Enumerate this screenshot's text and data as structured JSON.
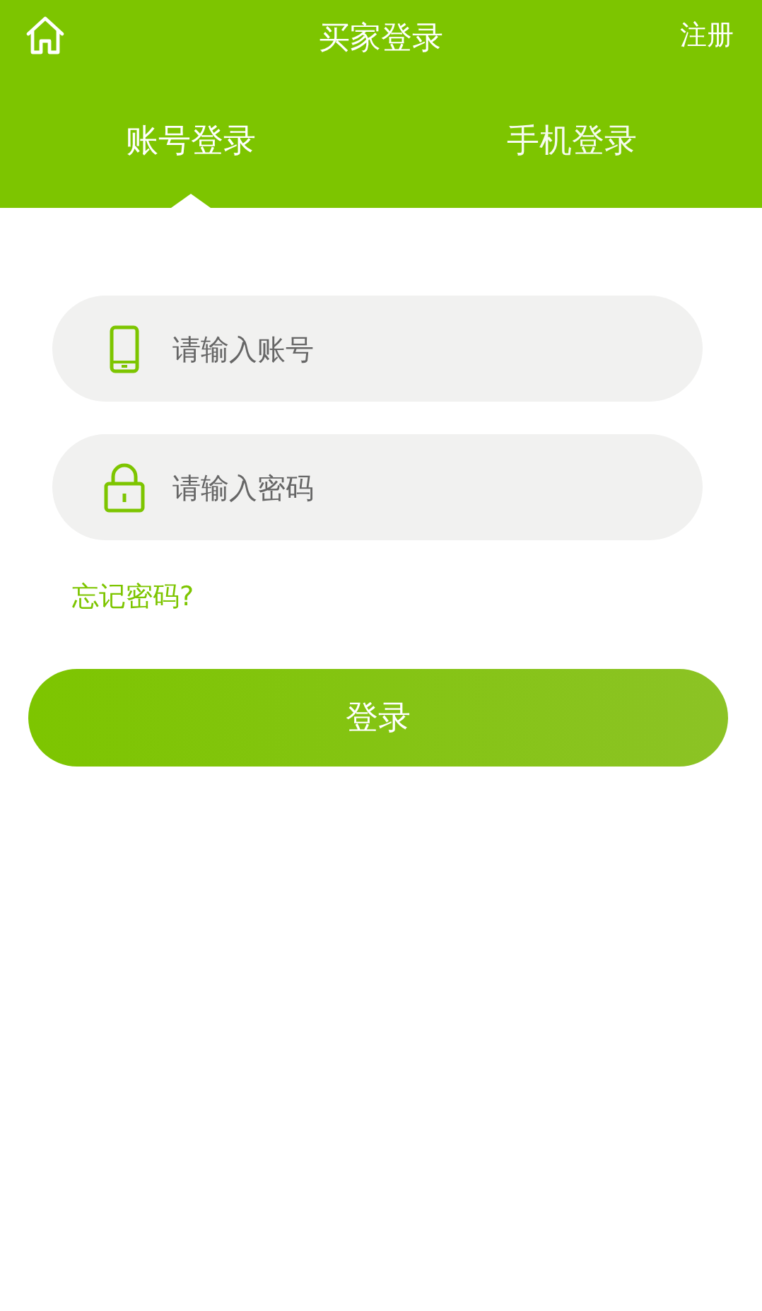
{
  "header": {
    "title": "买家登录",
    "register": "注册"
  },
  "tabs": [
    {
      "label": "账号登录",
      "selected": true
    },
    {
      "label": "手机登录",
      "selected": false
    }
  ],
  "fields": [
    {
      "kind": "phone",
      "placeholder": "请输入账号"
    },
    {
      "kind": "lock",
      "placeholder": "请输入密码"
    }
  ],
  "forgot_link": "忘记密码?",
  "login_button": "登录"
}
